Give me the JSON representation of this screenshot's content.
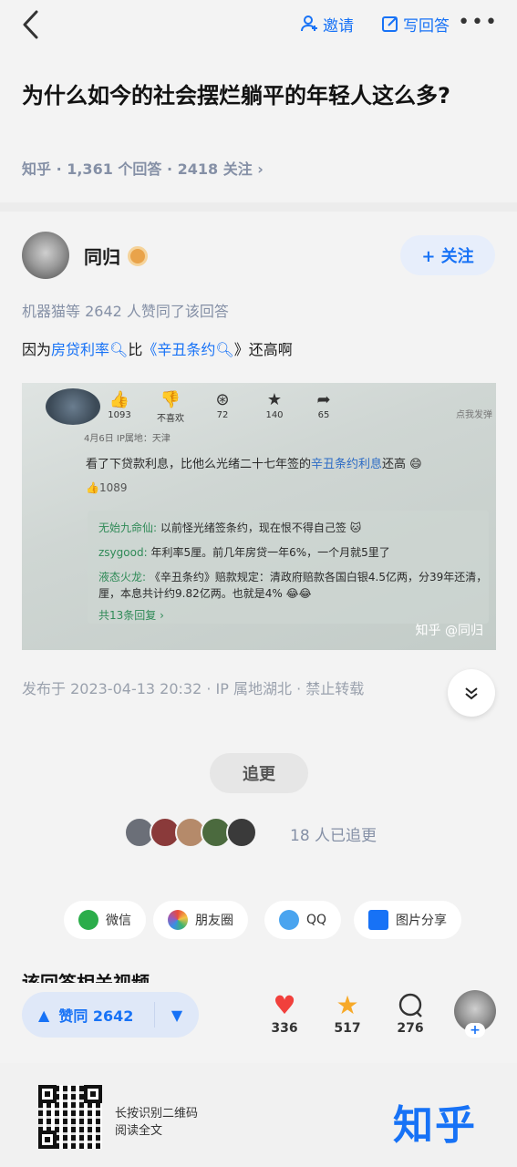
{
  "topbar": {
    "invite_label": "邀请",
    "write_label": "写回答",
    "more_label": "•••"
  },
  "question": {
    "title": "为什么如今的社会摆烂躺平的年轻人这么多?",
    "meta": "知乎 · 1,361 个回答 · 2418 关注 ›"
  },
  "answer": {
    "author": "同归",
    "follow_label": "+ 关注",
    "liked_by": "机器猫等 2642 人赞同了该回答",
    "content_prefix": "因为",
    "link1": "房贷利率",
    "content_mid": "比",
    "link2": "《辛丑条约",
    "content_suffix": "》还高啊",
    "published": "发布于 2023-04-13 20:32 · IP 属地湖北 · 禁止转载"
  },
  "photo": {
    "stats": [
      {
        "icon": "👍",
        "label": "1093"
      },
      {
        "icon": "👎",
        "label": "不喜欢"
      },
      {
        "icon": "⊛",
        "label": "72"
      },
      {
        "icon": "★",
        "label": "140"
      },
      {
        "icon": "➦",
        "label": "65"
      }
    ],
    "post_meta": "4月6日 IP属地：天津",
    "corner": "点我发弹",
    "post_text": "看了下贷款利息，比他么光绪二十七年签的",
    "post_link": "辛丑条约利息",
    "post_end": "还高 😄",
    "post_likes": "👍1089",
    "reply1_name": "无始九命仙:",
    "reply1_text": "以前怪光绪签条约，现在恨不得自己签 🐱",
    "reply2_name": "zsygood:",
    "reply2_text": "年利率5厘。前几年房贷一年6%，一个月就5里了",
    "reply3_name": "液态火龙:",
    "reply3_text": "《辛丑条约》赔款规定：清政府赔款各国白银4.5亿两，分39年还清，",
    "reply3_text2": "厘，本息共计约9.82亿两。也就是4% 😂😂",
    "reply_count": "共13条回复 ›",
    "watermark": "知乎 @同归"
  },
  "chase": {
    "button_label": "追更",
    "count_label": "18 人已追更"
  },
  "share": [
    {
      "label": "微信",
      "color": "#2bad4a"
    },
    {
      "label": "朋友圈",
      "color": "#e5b83b"
    },
    {
      "label": "QQ",
      "color": "#4aa4ef"
    },
    {
      "label": "图片分享",
      "color": "#1772f6"
    }
  ],
  "related_title": "该回答相关视频",
  "actions": {
    "vote_label": "赞同 2642",
    "like_count": "336",
    "favorite_count": "517",
    "comment_count": "276",
    "plus": "+"
  },
  "footer": {
    "hint_line1": "长按识别二维码",
    "hint_line2": "阅读全文",
    "logo": "知乎"
  },
  "colors": {
    "accent": "#1772f6",
    "heart": "#f1403c",
    "star": "#f7a928"
  }
}
